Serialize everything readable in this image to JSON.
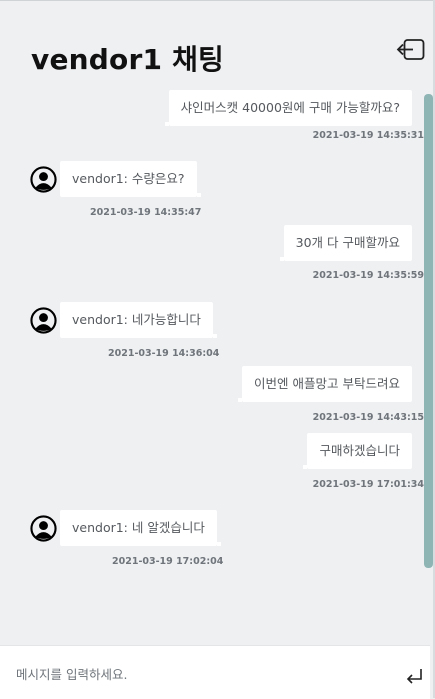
{
  "header": {
    "title": "vendor1 채팅",
    "exit_icon": "exit-icon"
  },
  "messages": [
    {
      "side": "mine",
      "text": "샤인머스캣 40000원에 구매 가능할까요?",
      "time": "2021-03-19 14:35:31"
    },
    {
      "side": "other",
      "text": "vendor1: 수량은요?",
      "time": "2021-03-19 14:35:47"
    },
    {
      "side": "mine",
      "text": "30개 다 구매할까요",
      "time": "2021-03-19 14:35:59"
    },
    {
      "side": "other",
      "text": "vendor1: 네가능합니다",
      "time": "2021-03-19 14:36:04"
    },
    {
      "side": "mine",
      "text": "이번엔 애플망고 부탁드려요",
      "time": "2021-03-19 14:43:15"
    },
    {
      "side": "mine",
      "text": "구매하겠습니다",
      "time": "2021-03-19 17:01:34"
    },
    {
      "side": "other",
      "text": "vendor1: 네 알겠습니다",
      "time": "2021-03-19 17:02:04"
    }
  ],
  "input": {
    "placeholder": "메시지를 입력하세요.",
    "value": "",
    "send_icon": "enter-icon"
  },
  "colors": {
    "background": "#eef0f2",
    "bubble": "#ffffff",
    "scrollbar": "#8fb4b4",
    "timestamp": "#6f757b"
  }
}
